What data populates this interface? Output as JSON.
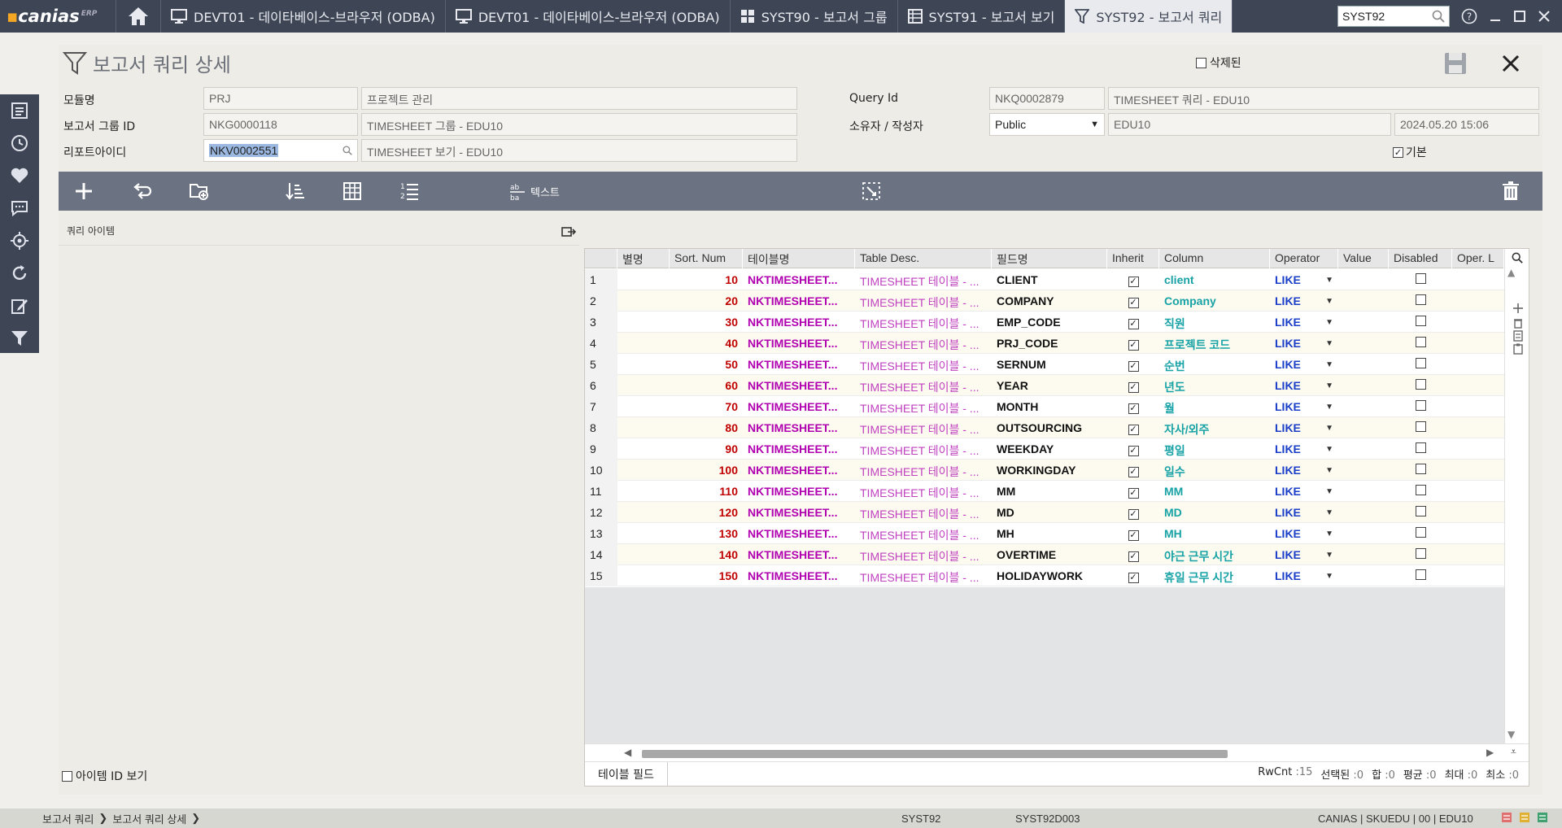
{
  "app": {
    "logo_text": "canias",
    "logo_sup": "ERP"
  },
  "tabs": [
    {
      "label": "DEVT01 - 데이타베이스-브라우저 (ODBA)",
      "icon": "monitor-icon"
    },
    {
      "label": "DEVT01 - 데이타베이스-브라우저 (ODBA)",
      "icon": "monitor-icon"
    },
    {
      "label": "SYST90 - 보고서 그룹",
      "icon": "grid-icon"
    },
    {
      "label": "SYST91 - 보고서 보기",
      "icon": "table-icon"
    },
    {
      "label": "SYST92 - 보고서 쿼리",
      "icon": "filter-icon",
      "active": true
    }
  ],
  "top_search": {
    "value": "SYST92"
  },
  "panel": {
    "title": "보고서 쿼리 상세",
    "deleted_label": "삭제된"
  },
  "form": {
    "module_label": "모듈명",
    "module_code": "PRJ",
    "module_name": "프로젝트 관리",
    "group_label": "보고서 그룹 ID",
    "group_code": "NKG0000118",
    "group_name": "TIMESHEET 그룹 - EDU10",
    "report_label": "리포트아이디",
    "report_code": "NKV0002551",
    "report_name": "TIMESHEET 보기 - EDU10",
    "query_label": "Query Id",
    "query_code": "NKQ0002879",
    "query_name": "TIMESHEET 쿼리 - EDU10",
    "owner_label": "소유자 / 작성자",
    "owner_value": "Public",
    "author_value": "EDU10",
    "date_value": "2024.05.20 15:06",
    "default_label": "기본"
  },
  "toolbar": {
    "text_label": "텍스트"
  },
  "left_pane": {
    "title": "쿼리 아이템",
    "show_id_label": "아이템  ID 보기"
  },
  "grid": {
    "headers": [
      "",
      "별명",
      "Sort. Num",
      "테이블명",
      "Table Desc.",
      "필드명",
      "Inherit",
      "Column",
      "Operator",
      "Value",
      "Disabled",
      "Oper. L"
    ],
    "rows": [
      {
        "no": "1",
        "sort": "10",
        "table": "NKTIMESHEET...",
        "desc": "TIMESHEET 테이블 - ...",
        "field": "CLIENT",
        "column": "client",
        "op": "LIKE"
      },
      {
        "no": "2",
        "sort": "20",
        "table": "NKTIMESHEET...",
        "desc": "TIMESHEET 테이블 - ...",
        "field": "COMPANY",
        "column": "Company",
        "op": "LIKE"
      },
      {
        "no": "3",
        "sort": "30",
        "table": "NKTIMESHEET...",
        "desc": "TIMESHEET 테이블 - ...",
        "field": "EMP_CODE",
        "column": "직원",
        "op": "LIKE"
      },
      {
        "no": "4",
        "sort": "40",
        "table": "NKTIMESHEET...",
        "desc": "TIMESHEET 테이블 - ...",
        "field": "PRJ_CODE",
        "column": "프로젝트 코드",
        "op": "LIKE"
      },
      {
        "no": "5",
        "sort": "50",
        "table": "NKTIMESHEET...",
        "desc": "TIMESHEET 테이블 - ...",
        "field": "SERNUM",
        "column": "순번",
        "op": "LIKE"
      },
      {
        "no": "6",
        "sort": "60",
        "table": "NKTIMESHEET...",
        "desc": "TIMESHEET 테이블 - ...",
        "field": "YEAR",
        "column": "년도",
        "op": "LIKE"
      },
      {
        "no": "7",
        "sort": "70",
        "table": "NKTIMESHEET...",
        "desc": "TIMESHEET 테이블 - ...",
        "field": "MONTH",
        "column": "월",
        "op": "LIKE"
      },
      {
        "no": "8",
        "sort": "80",
        "table": "NKTIMESHEET...",
        "desc": "TIMESHEET 테이블 - ...",
        "field": "OUTSOURCING",
        "column": "자사/외주",
        "op": "LIKE"
      },
      {
        "no": "9",
        "sort": "90",
        "table": "NKTIMESHEET...",
        "desc": "TIMESHEET 테이블 - ...",
        "field": "WEEKDAY",
        "column": "평일",
        "op": "LIKE"
      },
      {
        "no": "10",
        "sort": "100",
        "table": "NKTIMESHEET...",
        "desc": "TIMESHEET 테이블 - ...",
        "field": "WORKINGDAY",
        "column": "일수",
        "op": "LIKE"
      },
      {
        "no": "11",
        "sort": "110",
        "table": "NKTIMESHEET...",
        "desc": "TIMESHEET 테이블 - ...",
        "field": "MM",
        "column": "MM",
        "op": "LIKE"
      },
      {
        "no": "12",
        "sort": "120",
        "table": "NKTIMESHEET...",
        "desc": "TIMESHEET 테이블 - ...",
        "field": "MD",
        "column": "MD",
        "op": "LIKE"
      },
      {
        "no": "13",
        "sort": "130",
        "table": "NKTIMESHEET...",
        "desc": "TIMESHEET 테이블 - ...",
        "field": "MH",
        "column": "MH",
        "op": "LIKE"
      },
      {
        "no": "14",
        "sort": "140",
        "table": "NKTIMESHEET...",
        "desc": "TIMESHEET 테이블 - ...",
        "field": "OVERTIME",
        "column": "야근 근무 시간",
        "op": "LIKE"
      },
      {
        "no": "15",
        "sort": "150",
        "table": "NKTIMESHEET...",
        "desc": "TIMESHEET 테이블 - ...",
        "field": "HOLIDAYWORK",
        "column": "휴일 근무 시간",
        "op": "LIKE"
      }
    ],
    "footer_tab": "테이블 필드",
    "stats": [
      {
        "label": "RwCnt",
        "value": ":15"
      },
      {
        "label": "선택된",
        "value": ":0"
      },
      {
        "label": "합",
        "value": ":0"
      },
      {
        "label": "평균",
        "value": ":0"
      },
      {
        "label": "최대",
        "value": ":0"
      },
      {
        "label": "최소",
        "value": ":0"
      }
    ]
  },
  "statusbar": {
    "crumb1": "보고서 쿼리",
    "crumb2": "보고서 쿼리 상세",
    "program": "SYST92",
    "screen": "SYST92D003",
    "session": "CANIAS | SKUEDU | 00 | EDU10"
  },
  "colors": {
    "topbar": "#3e4656",
    "toolbar": "#6b7282",
    "sort": "#c00000",
    "table": "#b000b0",
    "column": "#17a2a6",
    "operator": "#1a3ec8"
  }
}
